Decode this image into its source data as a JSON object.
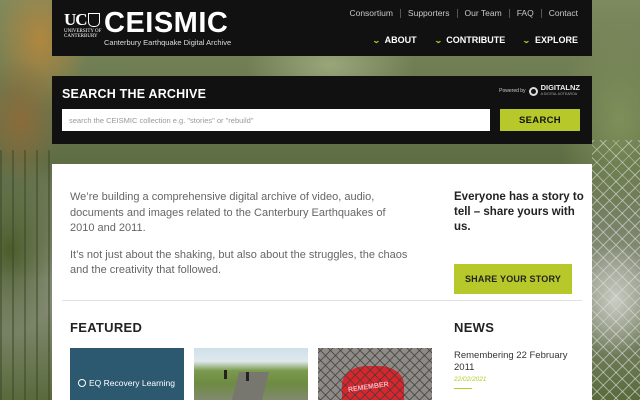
{
  "header": {
    "logo": {
      "uc": "UC",
      "university_line": "UNIVERSITY OF CANTERBURY"
    },
    "brand_name": "CEISMIC",
    "brand_subtitle": "Canterbury Earthquake Digital Archive",
    "utility_nav": [
      "Consortium",
      "Supporters",
      "Our Team",
      "FAQ",
      "Contact"
    ],
    "main_nav": [
      "ABOUT",
      "CONTRIBUTE",
      "EXPLORE"
    ]
  },
  "search": {
    "title": "SEARCH THE ARCHIVE",
    "powered_by": "Powered by",
    "partner": "DIGITALNZ",
    "partner_sub": "A DIGITAL AOTEAROA",
    "placeholder": "search the CEISMIC collection e.g. \"stories\" or \"rebuild\"",
    "button": "SEARCH"
  },
  "intro": {
    "paragraph1": "We’re building a comprehensive digital archive of video, audio, documents and images related to the Canterbury Earthquakes of 2010 and 2011.",
    "paragraph2": "It’s not just about the shaking, but also about the struggles, the chaos and the creativity that followed."
  },
  "story": {
    "title": "Everyone has a story to tell – share yours with us.",
    "button": "SHARE YOUR STORY"
  },
  "featured": {
    "heading": "FEATURED",
    "items": [
      {
        "label": "EQ Recovery Learning"
      },
      {
        "label": ""
      },
      {
        "label": "REMEMBER"
      }
    ]
  },
  "news": {
    "heading": "NEWS",
    "items": [
      {
        "title": "Remembering 22 February 2011",
        "date": "22/02/2021"
      }
    ]
  },
  "colors": {
    "accent": "#b7c92a",
    "header_bg": "#111111",
    "panel_bg": "#ffffff"
  }
}
